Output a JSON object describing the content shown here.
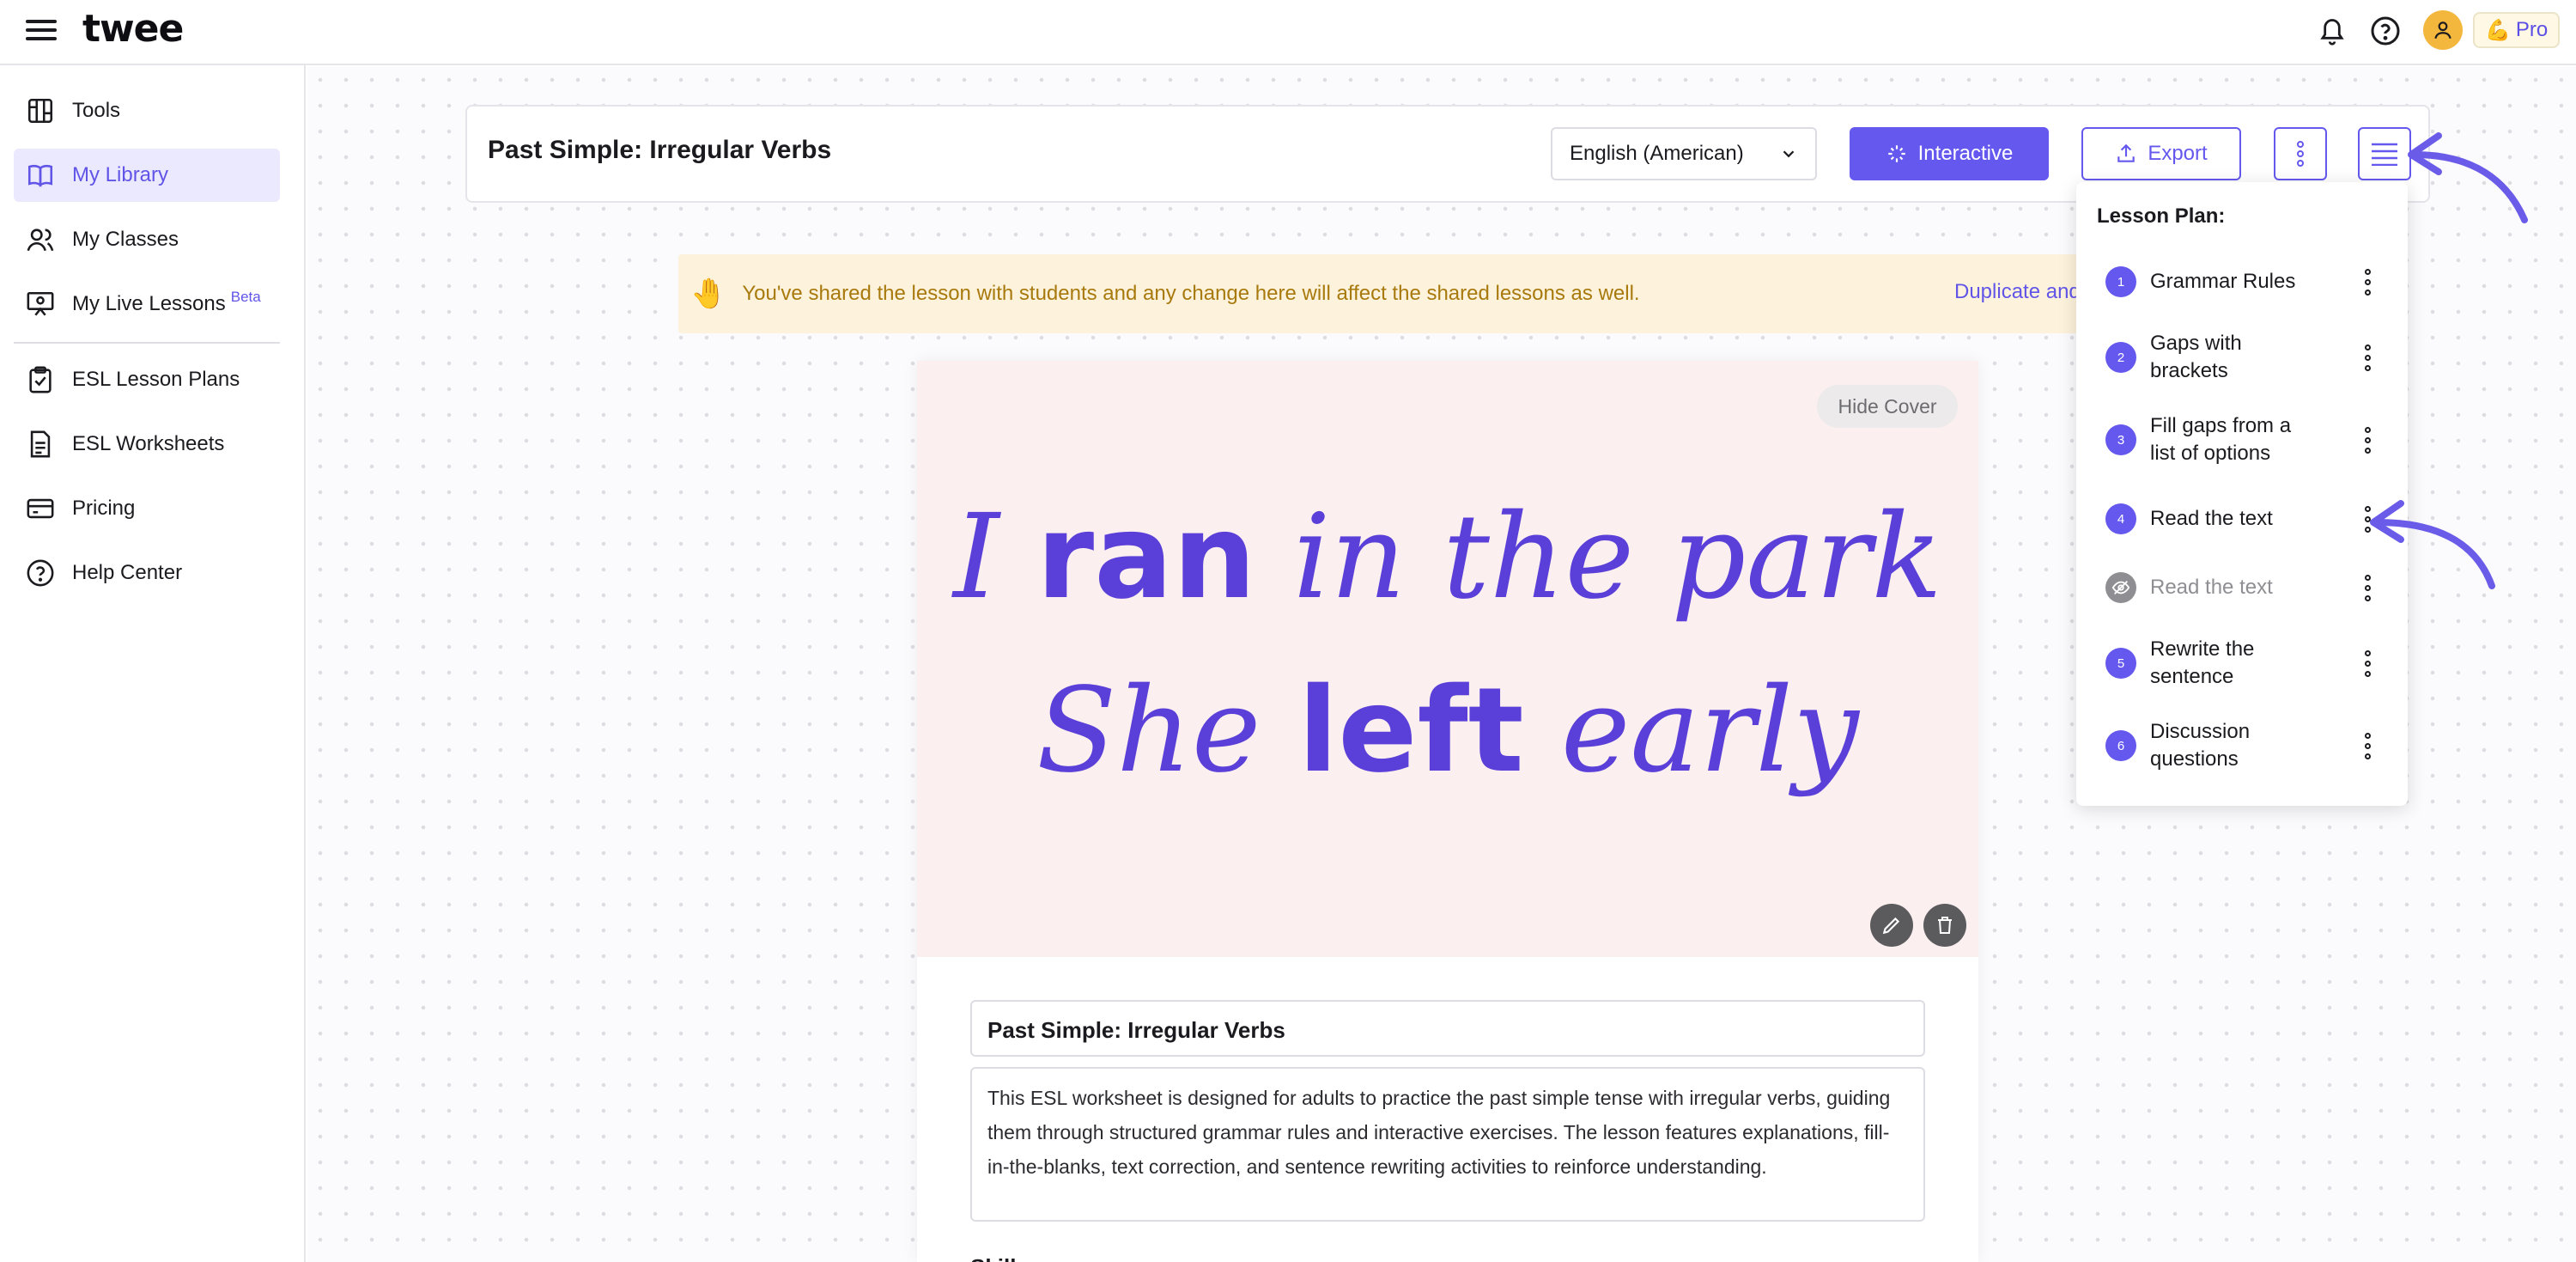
{
  "app": {
    "logo": "twee",
    "pro_label": "Pro"
  },
  "sidebar": {
    "items": [
      {
        "label": "Tools",
        "icon": "tools-icon"
      },
      {
        "label": "My Library",
        "icon": "book-icon",
        "active": true
      },
      {
        "label": "My Classes",
        "icon": "users-icon"
      },
      {
        "label": "My Live Lessons",
        "icon": "presentation-icon",
        "badge": "Beta"
      },
      {
        "label": "ESL Lesson Plans",
        "icon": "clipboard-icon"
      },
      {
        "label": "ESL Worksheets",
        "icon": "worksheet-icon"
      },
      {
        "label": "Pricing",
        "icon": "credit-card-icon"
      },
      {
        "label": "Help Center",
        "icon": "help-icon"
      }
    ]
  },
  "header": {
    "title": "Past Simple: Irregular Verbs",
    "language": "English (American)",
    "interactive_label": "Interactive",
    "export_label": "Export"
  },
  "banner": {
    "text": "You've shared the lesson with students and any change here will affect the shared lessons as well.",
    "action": "Duplicate and"
  },
  "cover": {
    "hide_label": "Hide Cover",
    "line1_a": "I ",
    "line1_bold": "ran",
    "line1_b": " in the park",
    "line2_a": "She ",
    "line2_bold": "left",
    "line2_b": " early"
  },
  "document": {
    "title": "Past Simple: Irregular Verbs",
    "description": "This ESL worksheet is designed for adults to practice the past simple tense with irregular verbs, guiding them through structured grammar rules and interactive exercises. The lesson features explanations, fill-in-the-blanks, text correction, and sentence rewriting activities to reinforce understanding.",
    "next_heading": "Skills"
  },
  "lesson_plan": {
    "title": "Lesson Plan:",
    "items": [
      {
        "num": "1",
        "label": "Grammar Rules"
      },
      {
        "num": "2",
        "label": "Gaps with brackets"
      },
      {
        "num": "3",
        "label": "Fill gaps from a list of options"
      },
      {
        "num": "4",
        "label": "Read the text"
      },
      {
        "num": "",
        "label": "Read the text",
        "hidden": true
      },
      {
        "num": "5",
        "label": "Rewrite the sentence"
      },
      {
        "num": "6",
        "label": "Discussion questions"
      }
    ]
  },
  "colors": {
    "accent": "#6558ee",
    "banner_bg": "#fdf3dc",
    "banner_text": "#a8790d",
    "cover_bg": "#fcefef",
    "cover_text": "#5a40d8"
  }
}
